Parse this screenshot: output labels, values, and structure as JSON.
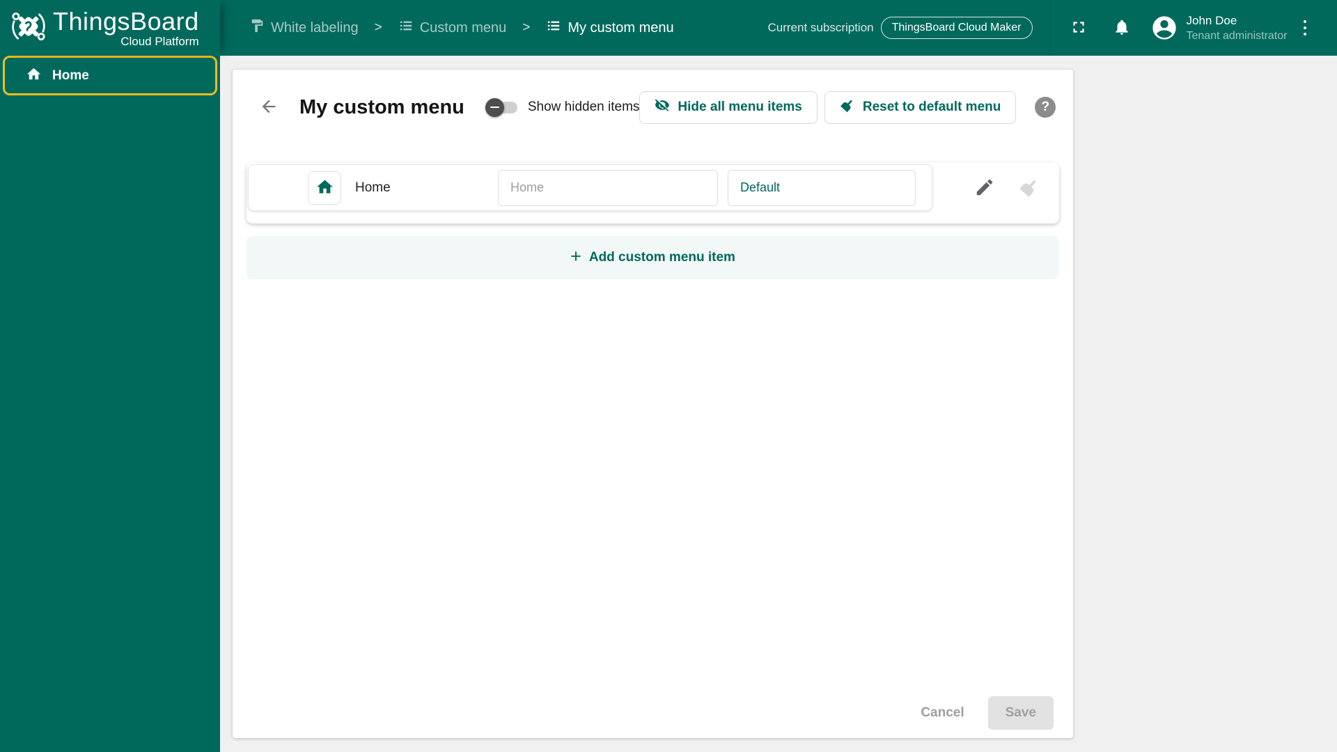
{
  "header": {
    "logo": {
      "title": "ThingsBoard",
      "subtitle": "Cloud Platform"
    },
    "breadcrumbs": [
      {
        "label": "White labeling",
        "icon": "paint-roller-icon",
        "active": false
      },
      {
        "label": "Custom menu",
        "icon": "list-icon",
        "active": false
      },
      {
        "label": "My custom menu",
        "icon": "list-icon",
        "active": true
      }
    ],
    "separator": ">",
    "subscription": {
      "label": "Current subscription",
      "plan": "ThingsBoard Cloud Maker"
    },
    "user": {
      "name": "John Doe",
      "role": "Tenant administrator"
    }
  },
  "sidebar": {
    "items": [
      {
        "label": "Home",
        "icon": "home-icon",
        "active": true
      }
    ]
  },
  "main": {
    "title": "My custom menu",
    "show_hidden_toggle": {
      "label": "Show hidden items",
      "state": "off"
    },
    "actions": {
      "hide_all": "Hide all menu items",
      "reset": "Reset to default menu",
      "help_glyph": "?"
    },
    "menu_items": [
      {
        "icon": "home-icon",
        "label": "Home",
        "name_placeholder": "Home",
        "pages_value": "Default"
      }
    ],
    "add_item": {
      "plus_glyph": "+",
      "label": "Add custom menu item"
    },
    "footer": {
      "cancel": "Cancel",
      "save": "Save",
      "save_enabled": false
    }
  },
  "colors": {
    "primary": "#00695c",
    "highlight_outline": "#ecbe1d",
    "page_bg": "#f0f0f0",
    "add_row_bg": "#f2f8f7"
  }
}
